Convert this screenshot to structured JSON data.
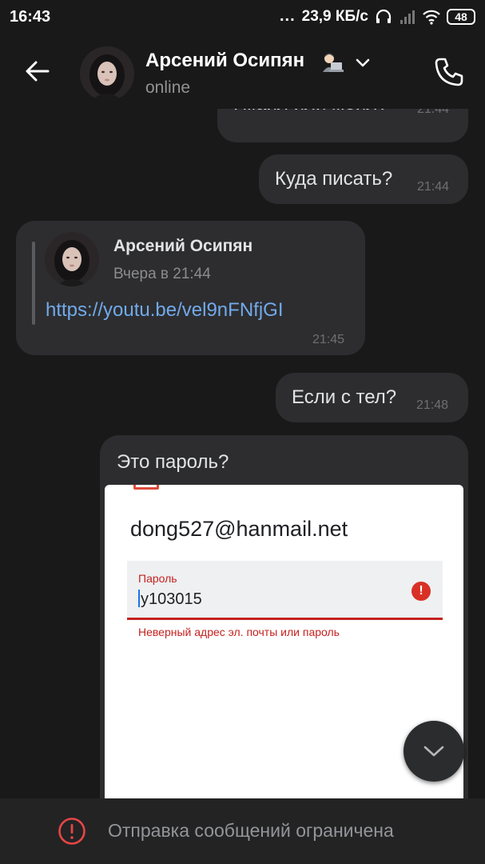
{
  "status_bar": {
    "time": "16:43",
    "dots": "...",
    "network_speed": "23,9 КБ/с",
    "battery": "48"
  },
  "header": {
    "contact_name": "Арсений Осипян",
    "status": "online",
    "icons": {
      "back": "arrow-left-icon",
      "chevron": "chevron-down-icon",
      "call": "phone-icon",
      "emoji": "man-technologist-emoji"
    }
  },
  "messages": [
    {
      "direction": "out",
      "text": "Гмаил или меил?",
      "time": "21:44"
    },
    {
      "direction": "out",
      "text": "Куда писать?",
      "time": "21:44"
    },
    {
      "direction": "in",
      "forwarded": {
        "author": "Арсений Осипян",
        "date": "Вчера в 21:44",
        "link": "https://youtu.be/vel9nFNfjGI"
      },
      "time": "21:45"
    },
    {
      "direction": "out",
      "text": "Если с тел?",
      "time": "21:48"
    },
    {
      "direction": "out",
      "text": "Это пароль?",
      "attachment": {
        "email": "dong527@hanmail.net",
        "field_label": "Пароль",
        "field_value": "y103015",
        "error_icon": "!",
        "error_text": "Неверный адрес эл. почты или пароль"
      }
    }
  ],
  "footer": {
    "notice": "Отправка сообщений ограничена",
    "icon": "alert-circle-icon"
  },
  "colors": {
    "background": "#19191a",
    "bubble": "#2d2d2f",
    "link": "#71aaeb",
    "error": "#e64646"
  }
}
